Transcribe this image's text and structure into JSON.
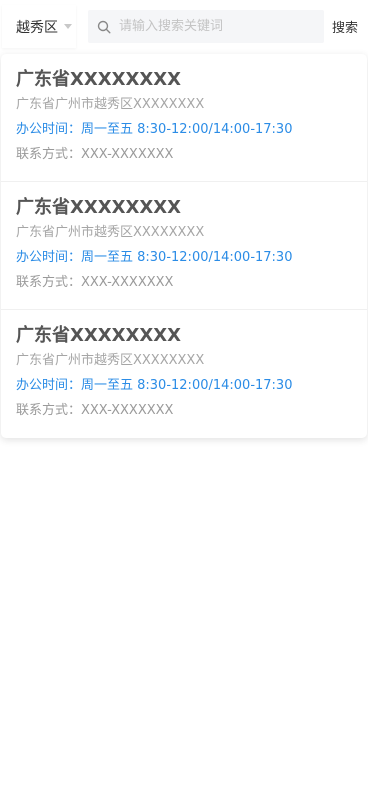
{
  "header": {
    "district_label": "越秀区",
    "search_placeholder": "请输入搜索关键词",
    "search_value": "",
    "search_button_label": "搜索"
  },
  "offices": [
    {
      "name": "广东省XXXXXXXX",
      "address": "广东省广州市越秀区XXXXXXXX",
      "hours": "办公时间：周一至五 8:30-12:00/14:00-17:30",
      "contact": "联系方式：XXX-XXXXXXX"
    },
    {
      "name": "广东省XXXXXXXX",
      "address": "广东省广州市越秀区XXXXXXXX",
      "hours": "办公时间：周一至五 8:30-12:00/14:00-17:30",
      "contact": "联系方式：XXX-XXXXXXX"
    },
    {
      "name": "广东省XXXXXXXX",
      "address": "广东省广州市越秀区XXXXXXXX",
      "hours": "办公时间：周一至五 8:30-12:00/14:00-17:30",
      "contact": "联系方式：XXX-XXXXXXX"
    }
  ],
  "colors": {
    "accent": "#2b8ce6",
    "title": "#555555",
    "muted": "#a6a6a6"
  }
}
